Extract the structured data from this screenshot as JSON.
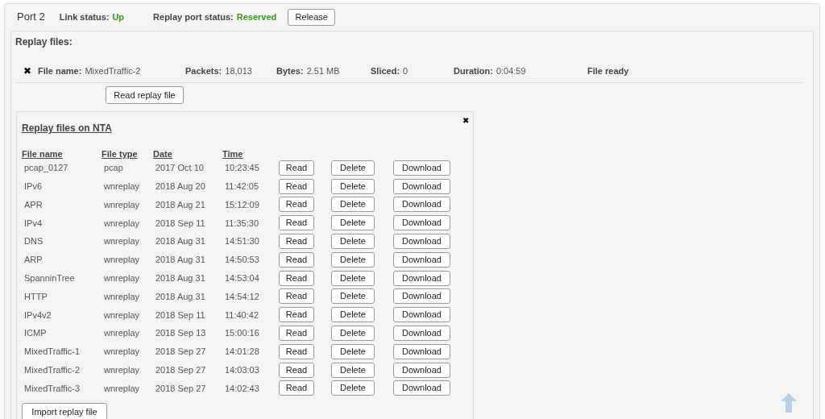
{
  "header": {
    "port": "Port 2",
    "link_status": {
      "label": "Link status:",
      "value": "Up"
    },
    "replay_port_status": {
      "label": "Replay port status:",
      "value": "Reserved"
    },
    "button": "Release"
  },
  "replay_files": {
    "title": "Replay files:",
    "loaded_file": {
      "remove_icon": "✖",
      "fields": [
        {
          "label": "File name:",
          "value": "MixedTraffic-2"
        },
        {
          "label": "Packets:",
          "value": "18,013"
        },
        {
          "label": "Bytes:",
          "value": "2.51 MB"
        },
        {
          "label": "Sliced:",
          "value": "0"
        },
        {
          "label": "Duration:",
          "value": "0:04:59"
        }
      ],
      "status": "File ready"
    },
    "read_button": "Read replay file",
    "nta_panel": {
      "title": "Replay files on NTA",
      "close_icon": "✖",
      "columns": [
        "File name",
        "File type",
        "Date",
        "Time"
      ],
      "rows": [
        {
          "file_name": "pcap_0127",
          "file_type": "pcap",
          "date": "2017 Oct 10",
          "time": "10:23:45",
          "actions": [
            "Read",
            "Delete",
            "Download"
          ]
        },
        {
          "file_name": "IPv6",
          "file_type": "wnreplay",
          "date": "2018 Aug 20",
          "time": "11:42:05",
          "actions": [
            "Read",
            "Delete",
            "Download"
          ]
        },
        {
          "file_name": "APR",
          "file_type": "wnreplay",
          "date": "2018 Aug 21",
          "time": "15:12:09",
          "actions": [
            "Read",
            "Delete",
            "Download"
          ]
        },
        {
          "file_name": "IPv4",
          "file_type": "wnreplay",
          "date": "2018 Sep 11",
          "time": "11:35:30",
          "actions": [
            "Read",
            "Delete",
            "Download"
          ]
        },
        {
          "file_name": "DNS",
          "file_type": "wnreplay",
          "date": "2018 Aug 31",
          "time": "14:51:30",
          "actions": [
            "Read",
            "Delete",
            "Download"
          ]
        },
        {
          "file_name": "ARP",
          "file_type": "wnreplay",
          "date": "2018 Aug 31",
          "time": "14:50:53",
          "actions": [
            "Read",
            "Delete",
            "Download"
          ]
        },
        {
          "file_name": "SpanninTree",
          "file_type": "wnreplay",
          "date": "2018 Aug 31",
          "time": "14:53:04",
          "actions": [
            "Read",
            "Delete",
            "Download"
          ]
        },
        {
          "file_name": "HTTP",
          "file_type": "wnreplay",
          "date": "2018 Aug 31",
          "time": "14:54:12",
          "actions": [
            "Read",
            "Delete",
            "Download"
          ]
        },
        {
          "file_name": "IPv4v2",
          "file_type": "wnreplay",
          "date": "2018 Sep 11",
          "time": "11:40:42",
          "actions": [
            "Read",
            "Delete",
            "Download"
          ]
        },
        {
          "file_name": "ICMP",
          "file_type": "wnreplay",
          "date": "2018 Sep 13",
          "time": "15:00:16",
          "actions": [
            "Read",
            "Delete",
            "Download"
          ]
        },
        {
          "file_name": "MixedTraffic-1",
          "file_type": "wnreplay",
          "date": "2018 Sep 27",
          "time": "14:01:28",
          "actions": [
            "Read",
            "Delete",
            "Download"
          ]
        },
        {
          "file_name": "MixedTraffic-2",
          "file_type": "wnreplay",
          "date": "2018 Sep 27",
          "time": "14:03:03",
          "actions": [
            "Read",
            "Delete",
            "Download"
          ]
        },
        {
          "file_name": "MixedTraffic-3",
          "file_type": "wnreplay",
          "date": "2018 Sep 27",
          "time": "14:02:43",
          "actions": [
            "Read",
            "Delete",
            "Download"
          ]
        }
      ],
      "import_button": "Import replay file"
    }
  }
}
